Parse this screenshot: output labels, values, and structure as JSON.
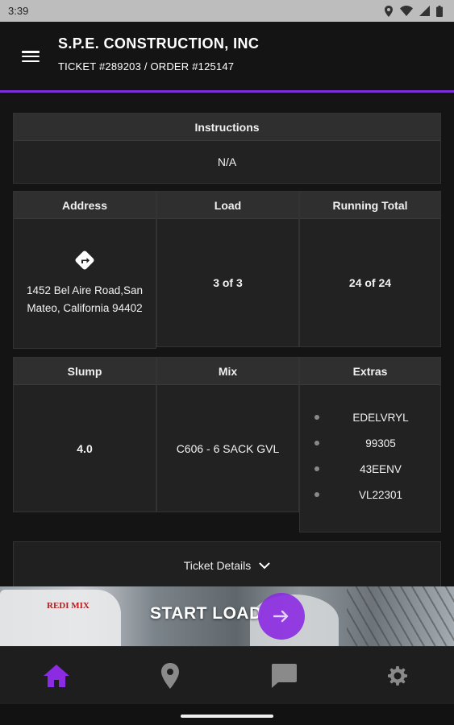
{
  "status_bar": {
    "time": "3:39",
    "icons": [
      "location-icon",
      "wifi-icon",
      "signal-icon",
      "battery-icon"
    ]
  },
  "app_bar": {
    "menu_icon": "hamburger-menu-icon",
    "company": "S.P.E. CONSTRUCTION, INC",
    "ticket_line": "TICKET #289203 / ORDER #125147",
    "accent_color": "#7b2fd6"
  },
  "instructions": {
    "header": "Instructions",
    "value": "N/A"
  },
  "address": {
    "header": "Address",
    "icon": "directions-icon",
    "value": "1452 Bel Aire Road,San Mateo, California 94402"
  },
  "load": {
    "header": "Load",
    "value": "3 of 3"
  },
  "running_total": {
    "header": "Running Total",
    "value": "24 of 24"
  },
  "slump": {
    "header": "Slump",
    "value": "4.0"
  },
  "mix": {
    "header": "Mix",
    "value": "C606 - 6 SACK GVL"
  },
  "extras": {
    "header": "Extras",
    "items": [
      "EDELVRYL",
      "99305",
      "43EENV",
      "VL22301"
    ]
  },
  "ticket_details": {
    "label": "Ticket Details",
    "icon": "chevron-down-icon"
  },
  "start_load": {
    "label": "START LOAD",
    "icon": "arrow-right-icon",
    "button_color": "#8b2be2",
    "truck_logo_text": "REDI MIX"
  },
  "bottom_nav": {
    "items": [
      {
        "name": "home",
        "icon": "home-icon",
        "active": true,
        "color": "#8b2be2"
      },
      {
        "name": "location",
        "icon": "map-pin-icon",
        "active": false,
        "color": "#8a8a8a"
      },
      {
        "name": "messages",
        "icon": "chat-icon",
        "active": false,
        "color": "#8a8a8a"
      },
      {
        "name": "settings",
        "icon": "gear-icon",
        "active": false,
        "color": "#8a8a8a"
      }
    ]
  }
}
